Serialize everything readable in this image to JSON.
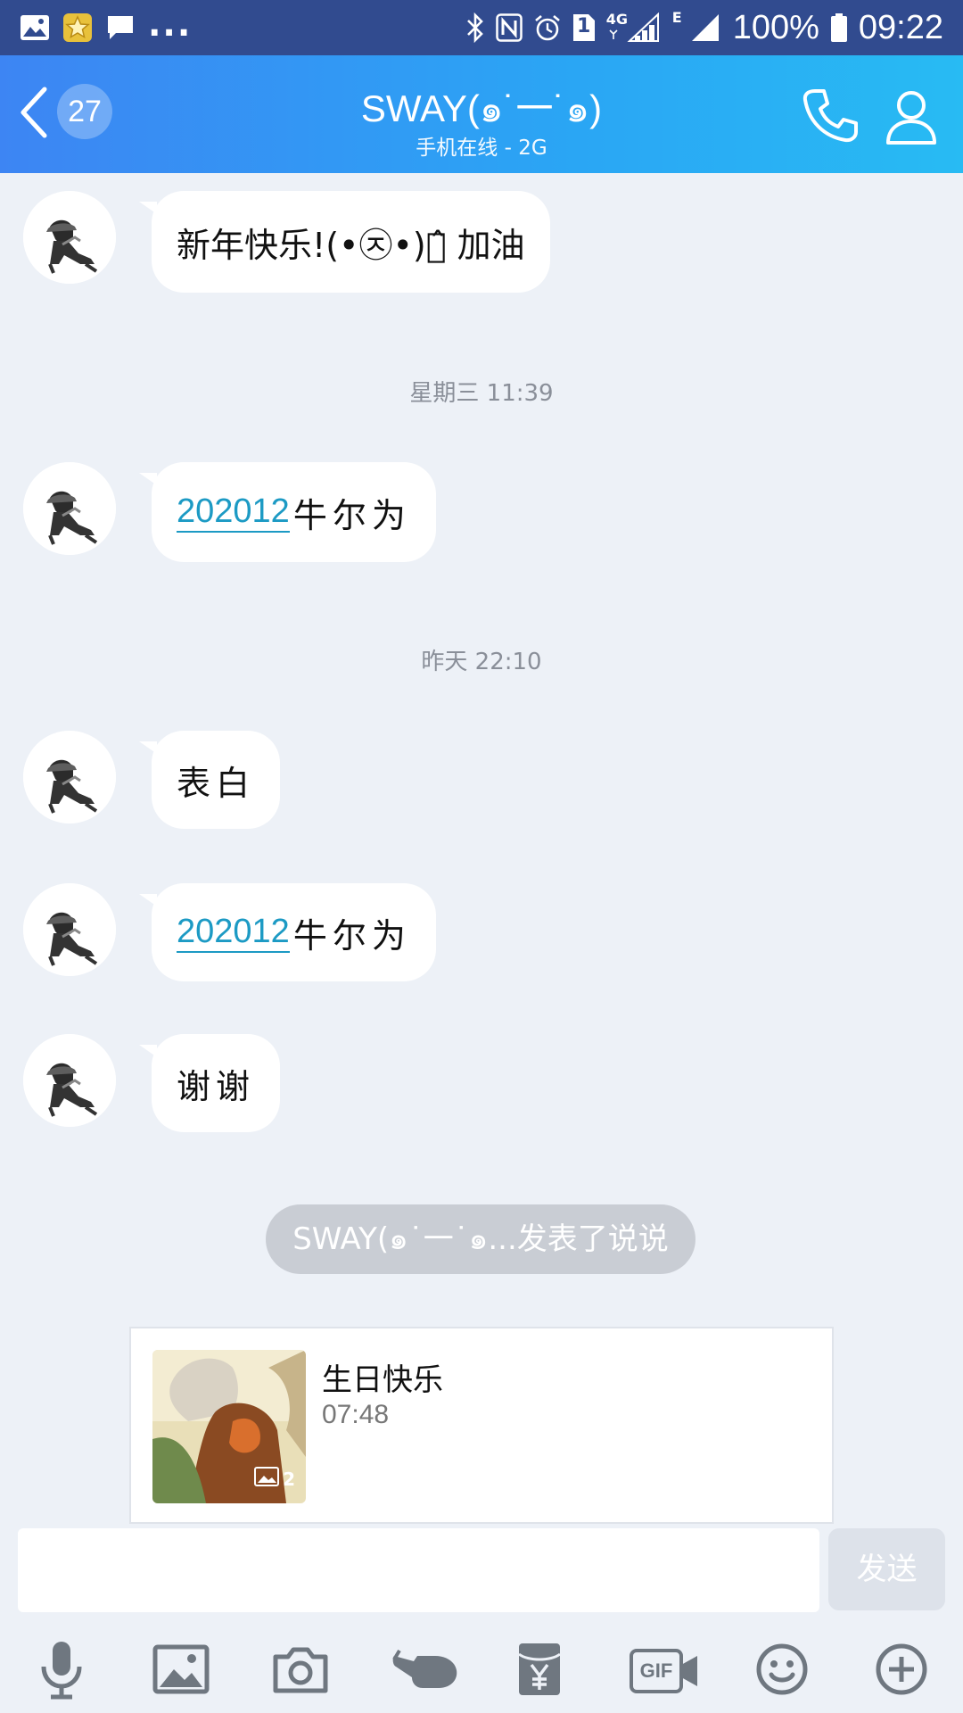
{
  "status_bar": {
    "left_more": "...",
    "network_4g": "4G",
    "network_e": "E",
    "sim_badge": "1",
    "battery_text": "100%",
    "time": "09:22"
  },
  "header": {
    "unread_count": "27",
    "title": "SWAY(๑˙一˙๑)",
    "subtitle": "手机在线 - 2G",
    "accent_start": "#3d85f3",
    "accent_end": "#28bbf3"
  },
  "messages": [
    {
      "text": "新年快乐!(•㉨•)ง̂ 加油"
    },
    {
      "time": "星期三 11:39"
    },
    {
      "link": "202012",
      "rest": "牛尔为"
    },
    {
      "time": "昨天 22:10"
    },
    {
      "text": "表白"
    },
    {
      "link": "202012",
      "rest": "牛尔为"
    },
    {
      "text": "谢谢"
    }
  ],
  "notice": "SWAY(๑˙一˙๑...发表了说说",
  "feed_card": {
    "title": "生日快乐",
    "time": "07:48",
    "photo_count": "2"
  },
  "composer": {
    "input_value": "",
    "send_label": "发送",
    "gif_label": "GIF"
  },
  "toolbar_icons": [
    "microphone-icon",
    "image-icon",
    "camera-icon",
    "poke-icon",
    "red-packet-icon",
    "gif-icon",
    "emoji-icon",
    "plus-icon"
  ]
}
